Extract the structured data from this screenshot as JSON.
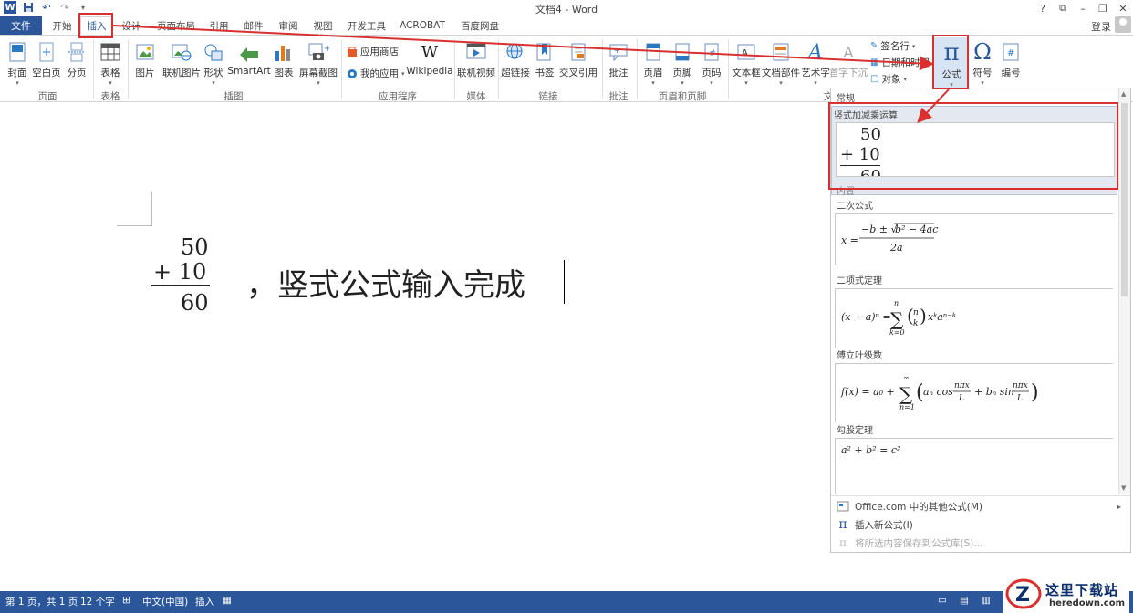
{
  "window": {
    "title": "文档4 - Word",
    "controls": [
      "?",
      "⧉",
      "–",
      "❐",
      "✕"
    ]
  },
  "tabs": {
    "file": "文件",
    "items": [
      "开始",
      "插入",
      "设计",
      "页面布局",
      "引用",
      "邮件",
      "审阅",
      "视图",
      "开发工具",
      "ACROBAT",
      "百度网盘"
    ],
    "active": "插入",
    "login": "登录"
  },
  "ribbon": {
    "buttons": {
      "cover": "封面",
      "blank": "空白页",
      "pagebreak": "分页",
      "table": "表格",
      "picture": "图片",
      "online_picture": "联机图片",
      "shapes": "形状",
      "smartart": "SmartArt",
      "chart": "图表",
      "screenshot": "屏幕截图",
      "app_store": "应用商店",
      "my_apps": "我的应用",
      "wikipedia": "Wikipedia",
      "online_video": "联机视频",
      "hyperlink": "超链接",
      "bookmark": "书签",
      "crossref": "交叉引用",
      "comment": "批注",
      "header": "页眉",
      "footer": "页脚",
      "page_number": "页码",
      "textbox": "文本框",
      "quickparts": "文档部件",
      "wordart": "艺术字",
      "dropcap": "首字下沉",
      "signature": "签名行",
      "datetime": "日期和时间",
      "object": "对象",
      "equation": "公式",
      "symbol": "符号",
      "number": "编号"
    },
    "groups": {
      "pages": "页面",
      "tables": "表格",
      "illustrations": "插图",
      "apps": "应用程序",
      "media": "媒体",
      "links": "链接",
      "comments": "批注",
      "header_footer": "页眉和页脚",
      "text": "文"
    }
  },
  "document": {
    "eq_top": "50",
    "eq_mid": "+ 10",
    "eq_result": "60",
    "text": "，竖式公式输入完成"
  },
  "gallery": {
    "section_general": "常规",
    "item_vertical_title": "竖式加减乘运算",
    "item_vertical_top": "50",
    "item_vertical_mid": "+ 10",
    "item_vertical_bottom": "60",
    "section_builtin": "内置",
    "quadratic_title": "二次公式",
    "binomial_title": "二项式定理",
    "fourier_title": "傅立叶级数",
    "pythagoras_title": "勾股定理",
    "menu": {
      "more": "Office.com 中的其他公式(M)",
      "insert_new": "插入新公式(I)",
      "save_selection": "将所选内容保存到公式库(S)..."
    }
  },
  "status": {
    "page": "第 1 页，共 1 页",
    "words": "12 个字",
    "language": "中文(中国)",
    "mode": "插入"
  },
  "watermark": {
    "title": "这里下载站",
    "sub": "heredown.com"
  },
  "colors": {
    "accent": "#2b579a",
    "annotation": "#d9302f"
  }
}
